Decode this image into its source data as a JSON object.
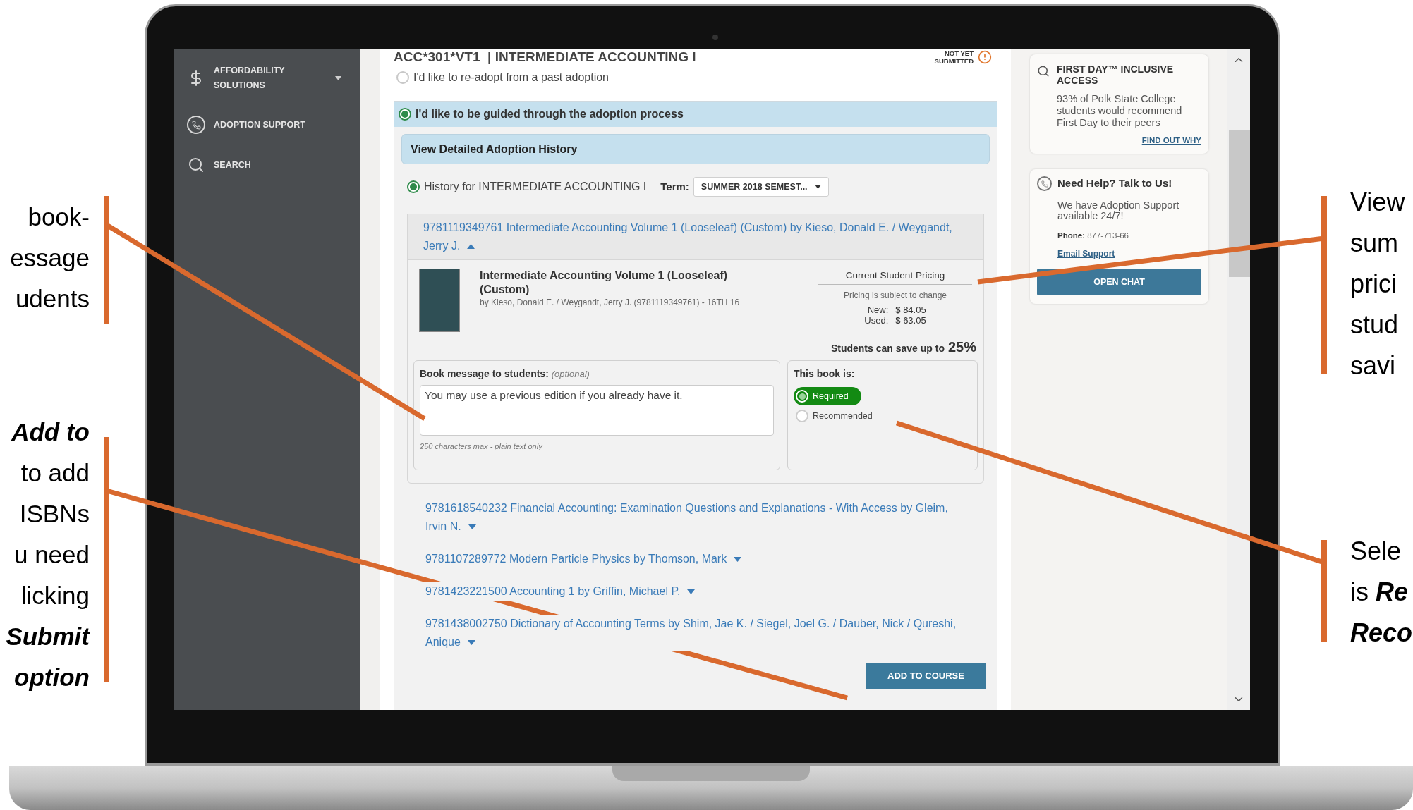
{
  "annotations_left": [
    {
      "lines": [
        [
          {
            "text": "book-",
            "emphasis": false
          }
        ],
        [
          {
            "text": "essage",
            "emphasis": false
          }
        ],
        [
          {
            "text": "udents",
            "emphasis": false
          }
        ]
      ]
    },
    {
      "lines": [
        [
          {
            "text": "Add to",
            "emphasis": true
          }
        ],
        [
          {
            "text": "to add",
            "emphasis": false
          }
        ],
        [
          {
            "text": "ISBNs",
            "emphasis": false
          }
        ],
        [
          {
            "text": "u need",
            "emphasis": false
          }
        ],
        [
          {
            "text": "licking",
            "emphasis": false
          }
        ],
        [
          {
            "text": "Submit",
            "emphasis": true
          }
        ],
        [
          {
            "text": "option",
            "emphasis": true
          }
        ]
      ]
    }
  ],
  "annotations_right": [
    {
      "lines": [
        [
          {
            "text": "View",
            "emphasis": false
          }
        ],
        [
          {
            "text": "sum",
            "emphasis": false
          }
        ],
        [
          {
            "text": "prici",
            "emphasis": false
          }
        ],
        [
          {
            "text": "stud",
            "emphasis": false
          }
        ],
        [
          {
            "text": "savi",
            "emphasis": false
          }
        ]
      ]
    },
    {
      "lines": [
        [
          {
            "text": "Sele",
            "emphasis": false
          }
        ],
        [
          {
            "text": "is",
            "emphasis": false
          },
          {
            "text": "Re",
            "emphasis": true
          }
        ],
        [
          {
            "text": "Reco",
            "emphasis": true
          }
        ]
      ]
    }
  ],
  "sidebar": {
    "items": [
      {
        "label": "AFFORDABILITY SOLUTIONS",
        "has_menu": true
      },
      {
        "label": "ADOPTION SUPPORT",
        "has_menu": false
      },
      {
        "label": "SEARCH",
        "has_menu": false
      }
    ]
  },
  "course": {
    "title": "ACC*301*VT1  | INTERMEDIATE ACCOUNTING I",
    "status_lines": [
      "NOT YET",
      "SUBMITTED"
    ]
  },
  "adoption_options": [
    {
      "label": "I'd like to re-adopt from a past adoption",
      "selected": false
    },
    {
      "label": "I'd like to be guided through the adoption process",
      "selected": true
    }
  ],
  "history": {
    "title": "View Detailed Adoption History",
    "option": {
      "label": "History for INTERMEDIATE ACCOUNTING I",
      "selected": true
    },
    "term_label": "Term:",
    "term_value": "SUMMER 2018 SEMEST..."
  },
  "books": [
    {
      "link": "9781119349761 Intermediate Accounting Volume 1 (Looseleaf) (Custom) by Kieso, Donald E. / Weygandt, Jerry J.",
      "expanded": true,
      "detail": {
        "title": "Intermediate Accounting Volume 1 (Looseleaf) (Custom)",
        "byline": "by Kieso, Donald E. / Weygandt, Jerry J. (9781119349761) - 16TH 16",
        "pricing_title": "Current Student Pricing",
        "pricing_note": "Pricing is subject to change",
        "prices": [
          {
            "label": "New:",
            "value": "$ 84.05"
          },
          {
            "label": "Used:",
            "value": "$ 63.05"
          }
        ],
        "savings_text": "Students can save up to",
        "savings_value": "25%",
        "message_label": "Book message to students:",
        "message_optional": "(optional)",
        "message_value": "You may use a previous edition if you already have it.",
        "message_hint": "250 characters max - plain text only",
        "status_label": "This book is:",
        "status_options": [
          {
            "label": "Required",
            "selected": true
          },
          {
            "label": "Recommended",
            "selected": false
          }
        ]
      }
    },
    {
      "link": "9781618540232 Financial Accounting: Examination Questions and Explanations - With Access by Gleim, Irvin N.",
      "expanded": false
    },
    {
      "link": "9781107289772 Modern Particle Physics by Thomson, Mark",
      "expanded": false
    },
    {
      "link": "9781423221500 Accounting 1 by Griffin, Michael P.",
      "expanded": false
    },
    {
      "link": "9781438002750 Dictionary of Accounting Terms by Shim, Jae K. / Siegel, Joel G. / Dauber, Nick / Qureshi, Anique",
      "expanded": false
    }
  ],
  "add_button": "ADD TO COURSE",
  "first_day_card": {
    "title": "FIRST DAY™ INCLUSIVE ACCESS",
    "body": "93% of Polk State College students would recommend First Day to their peers",
    "link": "FIND OUT WHY"
  },
  "help_card": {
    "title": "Need Help? Talk to Us!",
    "body": "We have Adoption Support available 24/7!",
    "phone_label": "Phone:",
    "phone": "877-713-66",
    "email_link": "Email Support",
    "button": "OPEN CHAT"
  }
}
